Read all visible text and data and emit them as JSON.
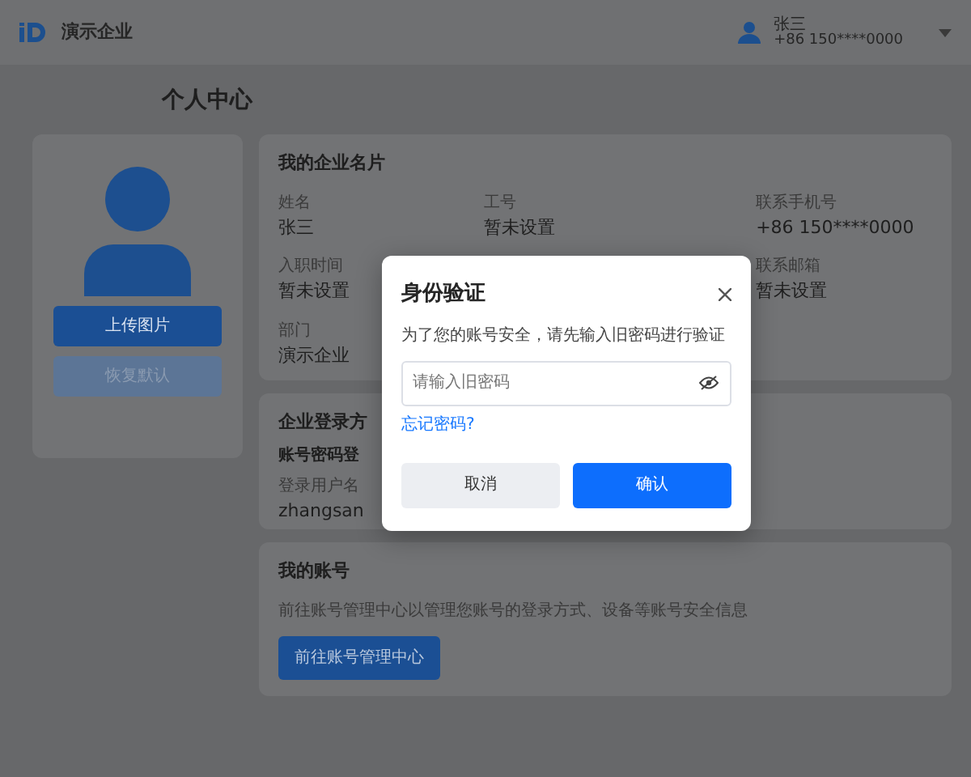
{
  "topbar": {
    "brand": "演示企业",
    "user": {
      "name": "张三",
      "phone": "+86 150****0000"
    }
  },
  "page_title": "个人中心",
  "profile": {
    "buttons": [
      {
        "label": "上传图片",
        "disabled": false
      },
      {
        "label": "恢复默认",
        "disabled": true
      }
    ]
  },
  "business_card": {
    "title": "我的企业名片",
    "columns": [
      [
        {
          "label": "姓名",
          "value": "张三"
        },
        {
          "label": "入职时间",
          "value": "暂未设置"
        },
        {
          "label": "部门",
          "value": "演示企业"
        }
      ],
      [
        {
          "label": "工号",
          "value": "暂未设置"
        }
      ],
      [
        {
          "label": "联系手机号",
          "value": "+86 150****0000"
        },
        {
          "label": "联系邮箱",
          "value": "暂未设置"
        }
      ]
    ]
  },
  "login_methods": {
    "title": "企业登录方",
    "subtitle": "账号密码登",
    "fields": [
      {
        "label": "登录用户名",
        "value": "zhangsan"
      }
    ]
  },
  "account": {
    "title": "我的账号",
    "description": "前往账号管理中心以管理您账号的登录方式、设备等账号安全信息",
    "button": "前往账号管理中心"
  },
  "dialog": {
    "title": "身份验证",
    "message": "为了您的账号安全，请先输入旧密码进行验证",
    "password": {
      "placeholder": "请输入旧密码"
    },
    "link": "忘记密码?",
    "buttons": [
      {
        "label": "取消",
        "kind": "secondary"
      },
      {
        "label": "确认",
        "kind": "primary"
      }
    ]
  }
}
